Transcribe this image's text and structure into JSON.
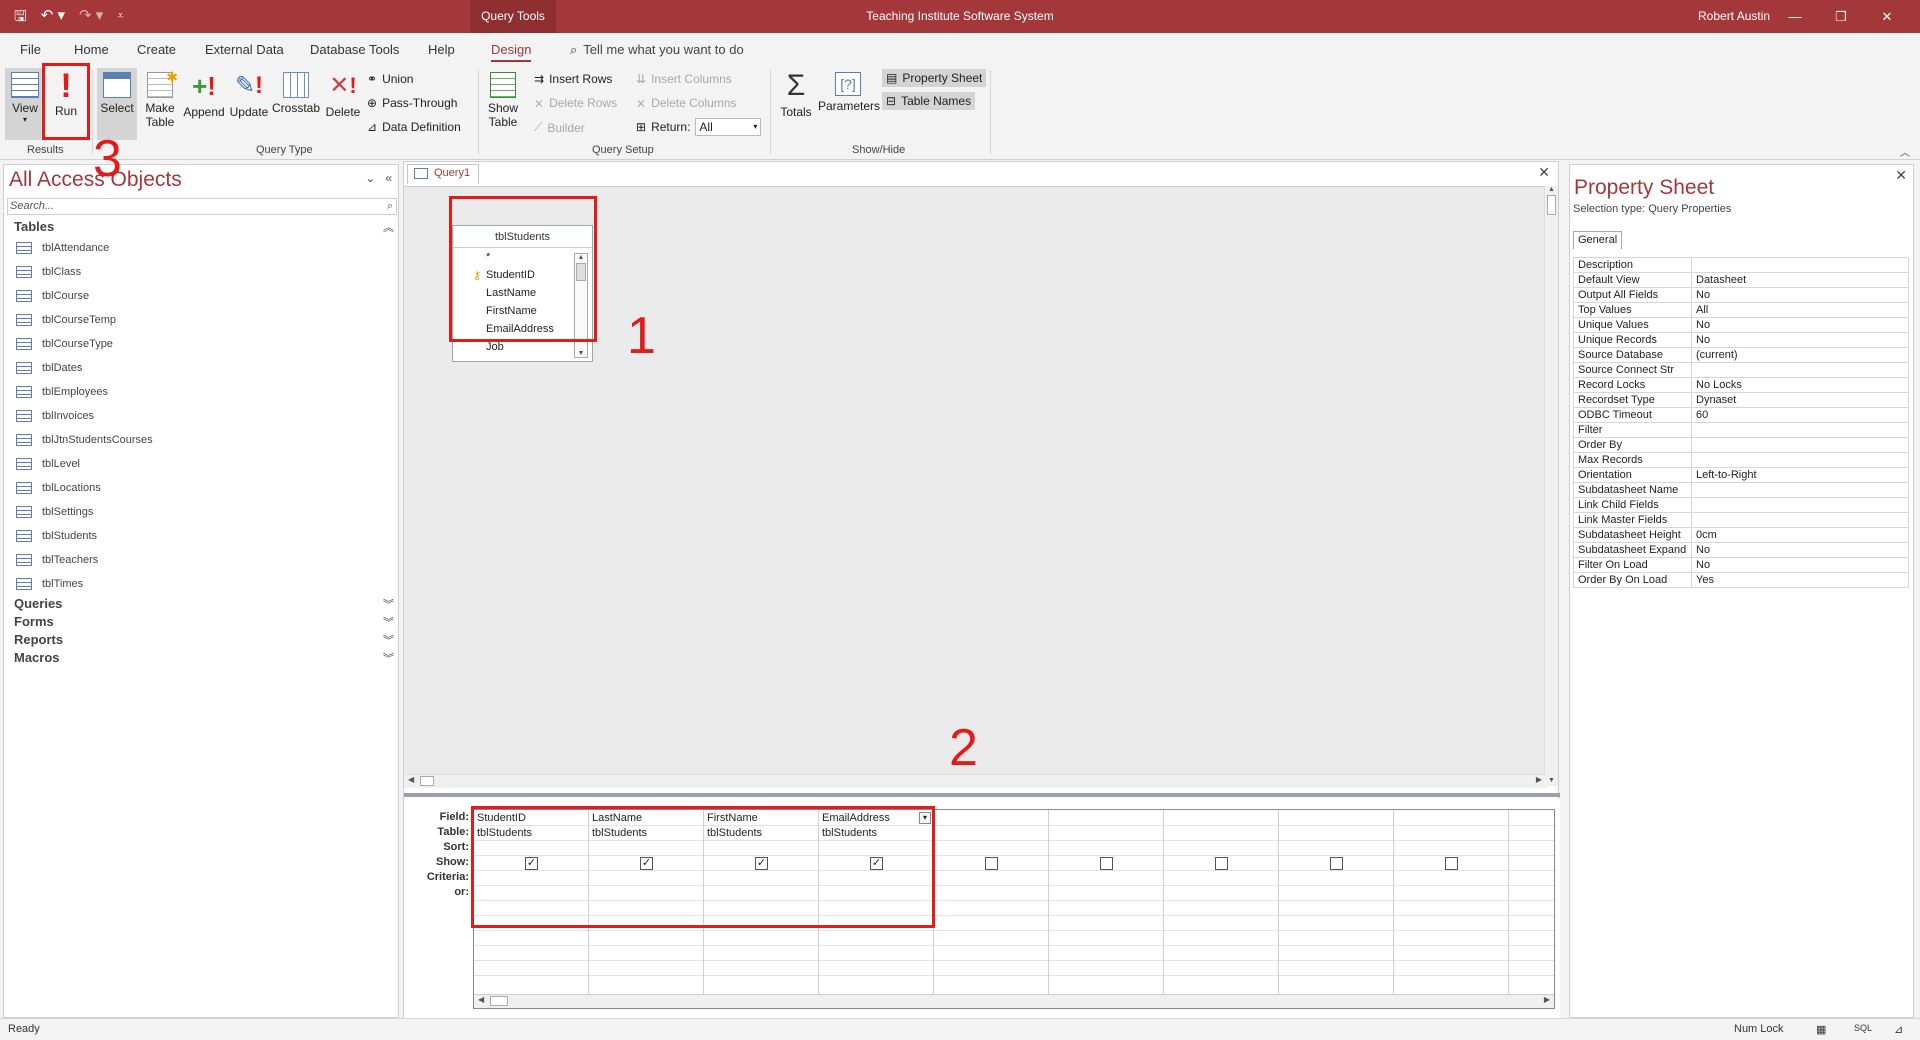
{
  "titlebar": {
    "context_tab": "Query Tools",
    "title": "Teaching Institute Software System",
    "user": "Robert Austin",
    "save_glyph": "🖫",
    "undo_glyph": "↶ ▾",
    "redo_glyph": "↷ ▾",
    "customize_glyph": "⩡",
    "minimize": "—",
    "restore": "❐",
    "close": "✕"
  },
  "menu": {
    "tabs": [
      "File",
      "Home",
      "Create",
      "External Data",
      "Database Tools",
      "Help",
      "Design"
    ],
    "active_tab": "Design",
    "tell_me": "Tell me what you want to do"
  },
  "ribbon": {
    "view_label": "View",
    "run_label": "Run",
    "results_group": "Results",
    "select_label": "Select",
    "make_table_line1": "Make",
    "make_table_line2": "Table",
    "append_label": "Append",
    "update_label": "Update",
    "crosstab_label": "Crosstab",
    "delete_label": "Delete",
    "union_label": "Union",
    "pass_through_label": "Pass-Through",
    "data_definition_label": "Data Definition",
    "query_type_group": "Query Type",
    "show_table_line1": "Show",
    "show_table_line2": "Table",
    "insert_rows_label": "Insert Rows",
    "delete_rows_label": "Delete Rows",
    "builder_label": "Builder",
    "insert_columns_label": "Insert Columns",
    "delete_columns_label": "Delete Columns",
    "return_label": "Return:",
    "return_value": "All",
    "query_setup_group": "Query Setup",
    "totals_label": "Totals",
    "parameters_label": "Parameters",
    "property_sheet_label": "Property Sheet",
    "table_names_label": "Table Names",
    "show_hide_group": "Show/Hide"
  },
  "nav": {
    "title": "All Access Objects",
    "search_placeholder": "Search...",
    "sections": {
      "tables": "Tables",
      "queries": "Queries",
      "forms": "Forms",
      "reports": "Reports",
      "macros": "Macros"
    },
    "tables": [
      "tblAttendance",
      "tblClass",
      "tblCourse",
      "tblCourseTemp",
      "tblCourseType",
      "tblDates",
      "tblEmployees",
      "tblInvoices",
      "tblJtnStudentsCourses",
      "tblLevel",
      "tblLocations",
      "tblSettings",
      "tblStudents",
      "tblTeachers",
      "tblTimes"
    ]
  },
  "query": {
    "tab_label": "Query1",
    "field_list": {
      "table": "tblStudents",
      "fields": [
        "*",
        "StudentID",
        "LastName",
        "FirstName",
        "EmailAddress",
        "Job"
      ]
    },
    "grid": {
      "row_labels": [
        "Field:",
        "Table:",
        "Sort:",
        "Show:",
        "Criteria:",
        "or:"
      ],
      "columns": [
        {
          "field": "StudentID",
          "table": "tblStudents",
          "show": true
        },
        {
          "field": "LastName",
          "table": "tblStudents",
          "show": true
        },
        {
          "field": "FirstName",
          "table": "tblStudents",
          "show": true
        },
        {
          "field": "EmailAddress",
          "table": "tblStudents",
          "show": true
        },
        {
          "field": "",
          "table": "",
          "show": false
        },
        {
          "field": "",
          "table": "",
          "show": false
        },
        {
          "field": "",
          "table": "",
          "show": false
        },
        {
          "field": "",
          "table": "",
          "show": false
        },
        {
          "field": "",
          "table": "",
          "show": false
        }
      ]
    }
  },
  "property_sheet": {
    "title": "Property Sheet",
    "selection_type": "Selection type:  Query Properties",
    "tab": "General",
    "rows": [
      [
        "Description",
        ""
      ],
      [
        "Default View",
        "Datasheet"
      ],
      [
        "Output All Fields",
        "No"
      ],
      [
        "Top Values",
        "All"
      ],
      [
        "Unique Values",
        "No"
      ],
      [
        "Unique Records",
        "No"
      ],
      [
        "Source Database",
        "(current)"
      ],
      [
        "Source Connect Str",
        ""
      ],
      [
        "Record Locks",
        "No Locks"
      ],
      [
        "Recordset Type",
        "Dynaset"
      ],
      [
        "ODBC Timeout",
        "60"
      ],
      [
        "Filter",
        ""
      ],
      [
        "Order By",
        ""
      ],
      [
        "Max Records",
        ""
      ],
      [
        "Orientation",
        "Left-to-Right"
      ],
      [
        "Subdatasheet Name",
        ""
      ],
      [
        "Link Child Fields",
        ""
      ],
      [
        "Link Master Fields",
        ""
      ],
      [
        "Subdatasheet Height",
        "0cm"
      ],
      [
        "Subdatasheet Expand",
        "No"
      ],
      [
        "Filter On Load",
        "No"
      ],
      [
        "Order By On Load",
        "Yes"
      ]
    ]
  },
  "status": {
    "ready": "Ready",
    "num_lock": "Num Lock",
    "sql_label": "SQL"
  },
  "annotations": [
    "1",
    "2",
    "3"
  ],
  "colors": {
    "accent": "#a4373a",
    "annotation": "#e31b1b"
  }
}
